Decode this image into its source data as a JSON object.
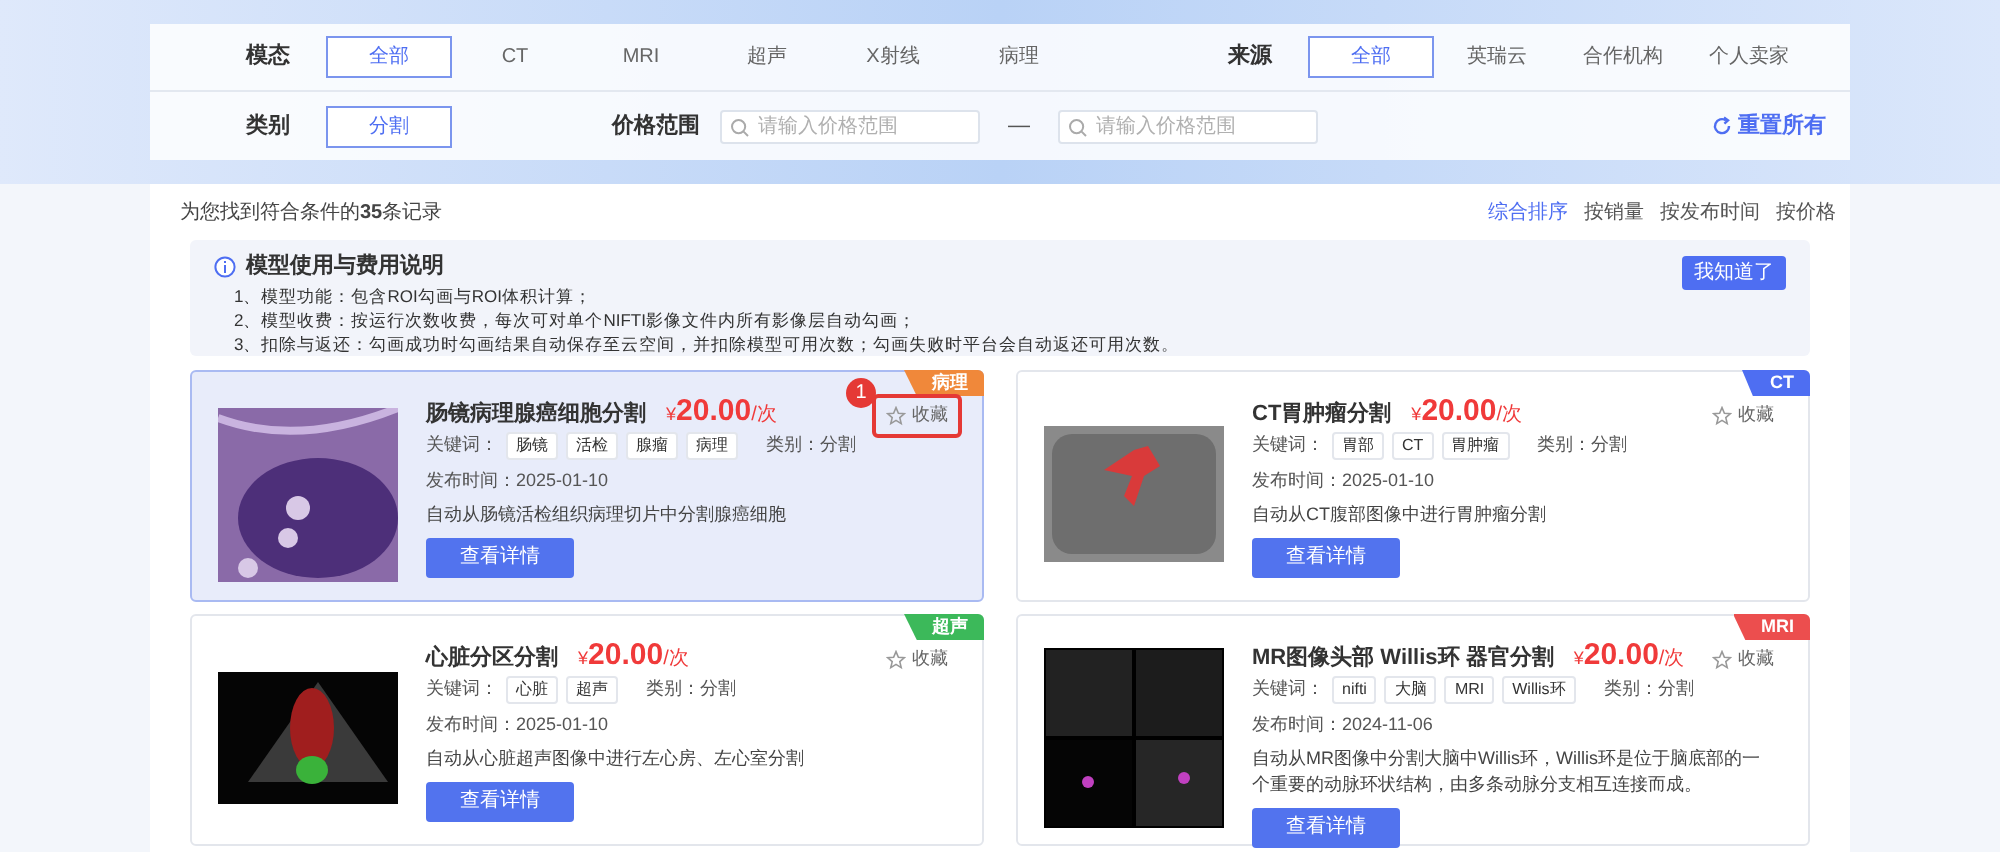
{
  "filters": {
    "rows": [
      {
        "groups": [
          {
            "label": "模态",
            "options": [
              {
                "text": "全部",
                "selected": true
              },
              {
                "text": "CT",
                "selected": false
              },
              {
                "text": "MRI",
                "selected": false
              },
              {
                "text": "超声",
                "selected": false
              },
              {
                "text": "X射线",
                "selected": false
              },
              {
                "text": "病理",
                "selected": false
              }
            ]
          },
          {
            "label": "来源",
            "options": [
              {
                "text": "全部",
                "selected": true
              },
              {
                "text": "英瑞云",
                "selected": false
              },
              {
                "text": "合作机构",
                "selected": false
              },
              {
                "text": "个人卖家",
                "selected": false
              }
            ]
          }
        ]
      },
      {
        "groups": [
          {
            "label": "类别",
            "options": [
              {
                "text": "分割",
                "selected": true
              }
            ]
          }
        ],
        "price": {
          "label": "价格范围",
          "min_placeholder": "请输入价格范围",
          "separator": "—",
          "max_placeholder": "请输入价格范围"
        },
        "reset": "重置所有"
      }
    ]
  },
  "results": {
    "summary": "为您找到符合条件的**35**条记录",
    "sorts": [
      {
        "text": "综合排序",
        "selected": true
      },
      {
        "text": "按销量",
        "selected": false
      },
      {
        "text": "按发布时间",
        "selected": false
      },
      {
        "text": "按价格",
        "selected": false
      }
    ]
  },
  "notice": {
    "title": "模型使用与费用说明",
    "button": "我知道了",
    "lines": [
      "1、模型功能：包含ROI勾画与ROI体积计算；",
      "2、模型收费：按运行次数收费，每次可对单个NIFTI影像文件内所有影像层自动勾画；",
      "3、扣除与返还：勾画成功时勾画结果自动保存至云空间，并扣除模型可用次数；勾画失败时平台会自动返还可用次数。"
    ]
  },
  "cards": [
    {
      "kind": "pathology",
      "title": "肠镜病理腺癌细胞分割",
      "currency": "¥",
      "price": "20.00",
      "unit": "/次",
      "tag": "病理",
      "color": "#f0883a",
      "favorite": "收藏",
      "keywords_label": "关键词：",
      "keywords": [
        "肠镜",
        "活检",
        "腺瘤",
        "病理"
      ],
      "category": "类别：分割",
      "date": "发布时间：2025-01-10",
      "description": "自动从肠镜活检组织病理切片中分割腺癌细胞",
      "button": "查看详情",
      "selected": true,
      "annotation": "1"
    },
    {
      "kind": "ct",
      "title": "CT胃肿瘤分割",
      "currency": "¥",
      "price": "20.00",
      "unit": "/次",
      "tag": "CT",
      "color": "#4e6ef2",
      "favorite": "收藏",
      "keywords_label": "关键词：",
      "keywords": [
        "胃部",
        "CT",
        "胃肿瘤"
      ],
      "category": "类别：分割",
      "date": "发布时间：2025-01-10",
      "description": "自动从CT腹部图像中进行胃肿瘤分割",
      "button": "查看详情",
      "selected": false
    },
    {
      "kind": "ultrasound",
      "title": "心脏分区分割",
      "currency": "¥",
      "price": "20.00",
      "unit": "/次",
      "tag": "超声",
      "color": "#3cb95a",
      "favorite": "收藏",
      "keywords_label": "关键词：",
      "keywords": [
        "心脏",
        "超声"
      ],
      "category": "类别：分割",
      "date": "发布时间：2025-01-10",
      "description": "自动从心脏超声图像中进行左心房、左心室分割",
      "button": "查看详情",
      "selected": false
    },
    {
      "kind": "mri",
      "title": "MR图像头部 Willis环 器官分割",
      "currency": "¥",
      "price": "20.00",
      "unit": "/次",
      "tag": "MRI",
      "color": "#ec4e4e",
      "favorite": "收藏",
      "keywords_label": "关键词：",
      "keywords": [
        "nifti",
        "大脑",
        "MRI",
        "Willis环"
      ],
      "category": "类别：分割",
      "date": "发布时间：2024-11-06",
      "description": "自动从MR图像中分割大脑中Willis环，Willis环是位于脑底部的一个重要的动脉环状结构，由多条动脉分支相互连接而成。",
      "button": "查看详情",
      "selected": false
    }
  ]
}
